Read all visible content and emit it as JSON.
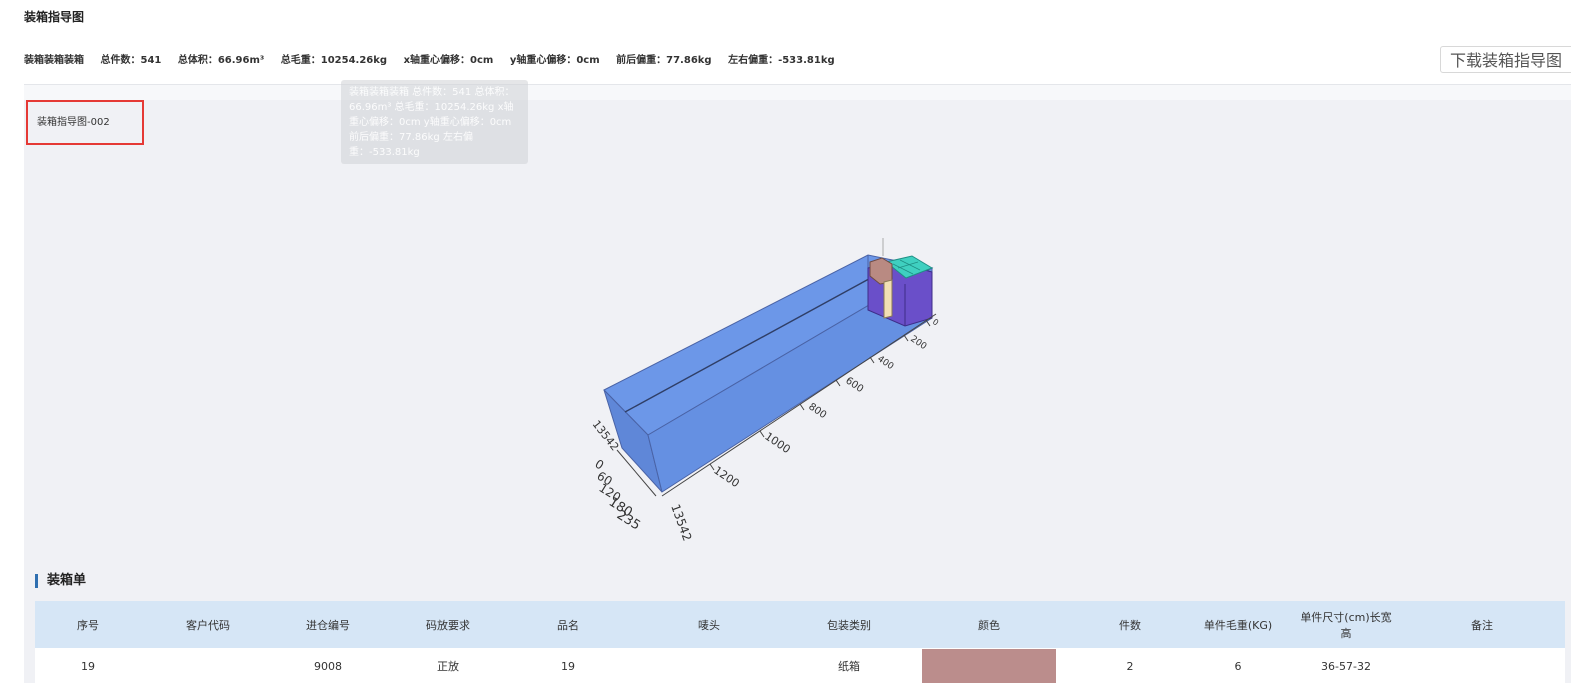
{
  "page": {
    "title": "装箱指导图"
  },
  "stats": {
    "container": "装箱装箱装箱",
    "total_pieces": "总件数：541",
    "total_volume": "总体积：66.96m³",
    "total_weight": "总毛重：10254.26kg",
    "x_offset": "x轴重心偏移：0cm",
    "y_offset": "y轴重心偏移：0cm",
    "front_back": "前后偏重：77.86kg",
    "left_right": "左右偏重：-533.81kg"
  },
  "download_label": "下载装箱指导图",
  "chart_name": "装箱指导图-002",
  "tooltip_text": "装箱装箱装箱 总件数：541 总体积：66.96m³ 总毛重：10254.26kg x轴重心偏移：0cm y轴重心偏移：0cm 前后偏重：77.86kg 左右偏重：-533.81kg",
  "axes": {
    "length_ticks": [
      "0",
      "200",
      "400",
      "600",
      "800",
      "1000",
      "1200",
      "13542"
    ],
    "height_ticks": [
      "0",
      "60",
      "120",
      "180",
      "235"
    ],
    "width_label": "13542"
  },
  "colors": {
    "container_top": "#6c97e8",
    "container_front": "#5f87d8",
    "cargo_purple": "#6a4fc9",
    "cargo_teal": "#3fd0c0",
    "cargo_brown": "#b98a82",
    "cargo_cream": "#f2dfb4",
    "row_swatch": "#bb8d8c",
    "header_bg": "#d6e6f6"
  },
  "section_title": "装箱单",
  "table": {
    "headers": [
      "序号",
      "客户代码",
      "进仓编号",
      "码放要求",
      "品名",
      "唛头",
      "包装类别",
      "颜色",
      "件数",
      "单件毛重(KG)",
      "单件尺寸(cm)长宽高",
      "备注"
    ],
    "rows": [
      {
        "no": "19",
        "customer": "",
        "entry": "9008",
        "stack": "正放",
        "name": "19",
        "mark": "",
        "pack": "纸箱",
        "color": "#bb8d8c",
        "qty": "2",
        "weight": "6",
        "size": "36-57-32",
        "note": ""
      }
    ]
  }
}
